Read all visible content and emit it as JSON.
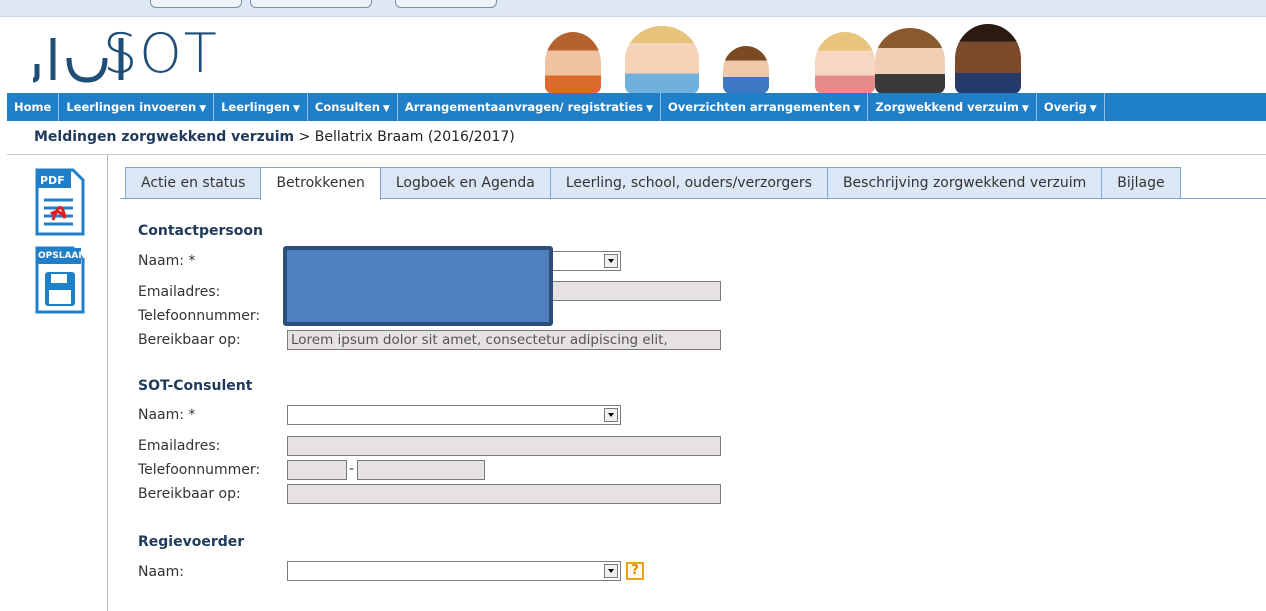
{
  "app": {
    "logo_text": "SOT",
    "colors": {
      "nav_bg": "#1f7fc9",
      "tab_bg": "#dbe7f4",
      "readonly_bg": "#e6e1e3",
      "title": "#1f3a5a",
      "redaction": "#4f7fbd"
    }
  },
  "nav": {
    "items": [
      {
        "label": "Home",
        "dropdown": false
      },
      {
        "label": "Leerlingen invoeren",
        "dropdown": true
      },
      {
        "label": "Leerlingen",
        "dropdown": true
      },
      {
        "label": "Consulten",
        "dropdown": true
      },
      {
        "label": "Arrangementaanvragen/ registraties",
        "dropdown": true
      },
      {
        "label": "Overzichten arrangementen",
        "dropdown": true
      },
      {
        "label": "Zorgwekkend verzuim",
        "dropdown": true
      },
      {
        "label": "Overig",
        "dropdown": true
      }
    ]
  },
  "breadcrumb": {
    "section": "Meldingen zorgwekkend verzuim",
    "separator": ">",
    "current": "Bellatrix Braam (2016/2017)"
  },
  "actions": {
    "pdf_label": "PDF",
    "save_label": "OPSLAAN"
  },
  "tabs": [
    {
      "label": "Actie en status",
      "active": false
    },
    {
      "label": "Betrokkenen",
      "active": true
    },
    {
      "label": "Logboek en Agenda",
      "active": false
    },
    {
      "label": "Leerling, school, ouders/verzorgers",
      "active": false
    },
    {
      "label": "Beschrijving zorgwekkend verzuim",
      "active": false
    },
    {
      "label": "Bijlage",
      "active": false
    }
  ],
  "contactpersoon": {
    "title": "Contactpersoon",
    "naam_label": "Naam: *",
    "email_label": "Emailadres:",
    "telefoon_label": "Telefoonnummer:",
    "bereikbaar_label": "Bereikbaar op:",
    "bereikbaar_value": "Lorem ipsum dolor sit amet, consectetur adipiscing elit,"
  },
  "consulent": {
    "title": "SOT-Consulent",
    "naam_label": "Naam: *",
    "email_label": "Emailadres:",
    "telefoon_label": "Telefoonnummer:",
    "telefoon_sep": "-",
    "bereikbaar_label": "Bereikbaar op:"
  },
  "regievoerder": {
    "title": "Regievoerder",
    "naam_label": "Naam:",
    "help_label": "?"
  }
}
